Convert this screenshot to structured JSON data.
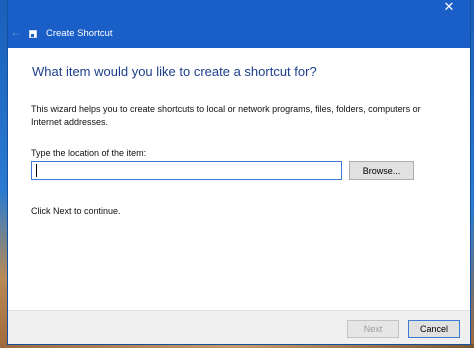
{
  "window": {
    "title": "Create Shortcut",
    "close_glyph": "✕",
    "back_glyph": "←",
    "accent_color": "#1a5fc8"
  },
  "main": {
    "heading": "What item would you like to create a shortcut for?",
    "description": "This wizard helps you to create shortcuts to local or network programs, files, folders, computers or Internet addresses.",
    "location_label": "Type the location of the item:",
    "location_value": "",
    "browse_label": "Browse...",
    "continue_hint": "Click Next to continue."
  },
  "footer": {
    "next_label": "Next",
    "next_enabled": false,
    "cancel_label": "Cancel"
  }
}
